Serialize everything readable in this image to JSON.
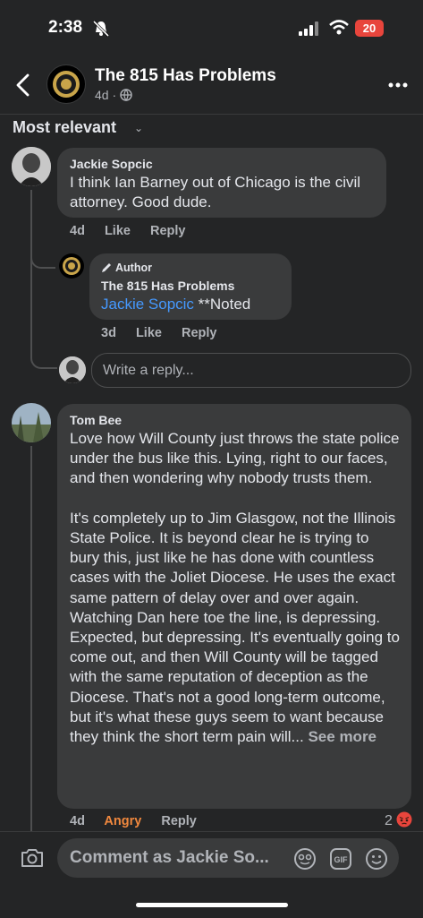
{
  "status_bar": {
    "time": "2:38",
    "battery": "20"
  },
  "header": {
    "title": "The 815 Has Problems",
    "meta": "4d ·"
  },
  "sort": {
    "label": "Most relevant"
  },
  "comments": [
    {
      "name": "Jackie Sopcic",
      "text": "I think Ian Barney out of Chicago is the civil attorney. Good dude.",
      "time": "4d",
      "like": "Like",
      "reply": "Reply"
    },
    {
      "author_badge": "Author",
      "name": "The 815 Has Problems",
      "mention": "Jackie Sopcic",
      "text": " **Noted",
      "time": "3d",
      "like": "Like",
      "reply": "Reply"
    },
    {
      "name": "Tom Bee",
      "text": "Love how Will County just throws the state police under the bus like this. Lying, right to our faces, and then wondering why nobody trusts them.\n\nIt's completely up to Jim Glasgow, not the Illinois State Police. It is beyond clear he is trying to bury this, just like he has done with countless cases with the Joliet Diocese. He uses the exact same pattern of delay over and over again. Watching Dan here toe the line, is depressing. Expected, but depressing. It's eventually going to come out, and then Will County will be tagged with the same reputation of deception as the Diocese. That's not a good long-term outcome, but it's what these guys seem to want because they think the short term pain will...",
      "see_more": "See more",
      "time": "4d",
      "reaction_label": "Angry",
      "reply": "Reply",
      "reaction_count": "2"
    }
  ],
  "reply_box": {
    "placeholder": "Write a reply..."
  },
  "composer": {
    "placeholder": "Comment as Jackie So..."
  },
  "icons": {
    "back": "chevron-left-icon",
    "more": "more-horizontal-icon",
    "camera": "camera-icon",
    "sticker": "sticker-icon",
    "gif": "gif-icon",
    "emoji": "emoji-icon"
  },
  "colors": {
    "mention": "#4599ff",
    "angry": "#f0883e",
    "battery": "#e8453c"
  }
}
